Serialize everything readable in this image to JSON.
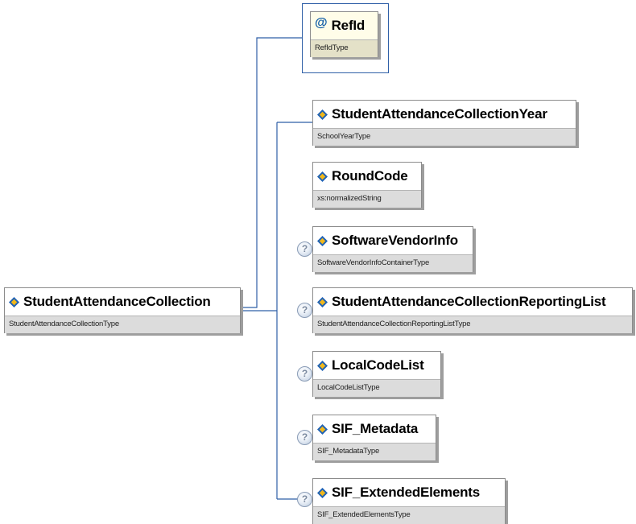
{
  "root": {
    "name": "StudentAttendanceCollection",
    "type": "StudentAttendanceCollectionType"
  },
  "attribute": {
    "symbol": "@",
    "name": "RefId",
    "type": "RefIdType"
  },
  "optional_marker": "?",
  "children": [
    {
      "name": "StudentAttendanceCollectionYear",
      "type": "SchoolYearType",
      "optional": false
    },
    {
      "name": "RoundCode",
      "type": "xs:normalizedString",
      "optional": false
    },
    {
      "name": "SoftwareVendorInfo",
      "type": "SoftwareVendorInfoContainerType",
      "optional": true
    },
    {
      "name": "StudentAttendanceCollectionReportingList",
      "type": "StudentAttendanceCollectionReportingListType",
      "optional": true
    },
    {
      "name": "LocalCodeList",
      "type": "LocalCodeListType",
      "optional": true
    },
    {
      "name": "SIF_Metadata",
      "type": "SIF_MetadataType",
      "optional": true
    },
    {
      "name": "SIF_ExtendedElements",
      "type": "SIF_ExtendedElementsType",
      "optional": true
    }
  ],
  "colors": {
    "connector": "#2f5fa7",
    "element_icon_blue": "#1f62b5",
    "element_icon_gold": "#f2b81a",
    "type_band": "#dcdcdc",
    "attribute_fill": "#fffde9"
  }
}
